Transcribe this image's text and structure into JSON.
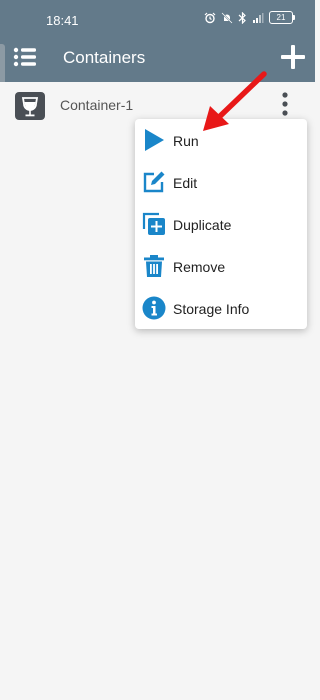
{
  "status_bar": {
    "time": "18:41",
    "battery": "21"
  },
  "app_bar": {
    "title": "Containers",
    "menu_icon": "list-menu-icon",
    "add_icon": "plus-icon"
  },
  "containers": [
    {
      "name": "Container-1",
      "icon": "wine-glass-box-icon"
    }
  ],
  "context_menu": {
    "items": [
      {
        "label": "Run",
        "icon": "play-icon"
      },
      {
        "label": "Edit",
        "icon": "edit-icon"
      },
      {
        "label": "Duplicate",
        "icon": "duplicate-icon"
      },
      {
        "label": "Remove",
        "icon": "trash-icon"
      },
      {
        "label": "Storage Info",
        "icon": "info-icon"
      }
    ]
  },
  "colors": {
    "app_bar": "#637a8a",
    "icon_blue": "#1a86c9",
    "arrow_red": "#e81818"
  }
}
